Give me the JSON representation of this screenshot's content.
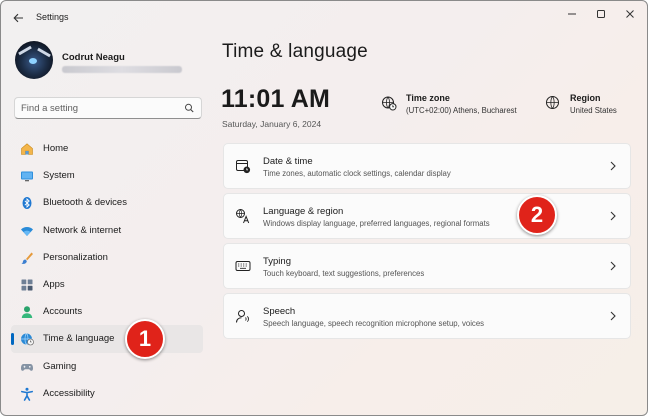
{
  "app": {
    "title": "Settings"
  },
  "user": {
    "name": "Codrut Neagu"
  },
  "search": {
    "placeholder": "Find a setting"
  },
  "sidebar": {
    "items": [
      {
        "label": "Home",
        "icon": "home-icon",
        "active": false
      },
      {
        "label": "System",
        "icon": "monitor-icon",
        "active": false
      },
      {
        "label": "Bluetooth & devices",
        "icon": "bluetooth-icon",
        "active": false
      },
      {
        "label": "Network & internet",
        "icon": "wifi-icon",
        "active": false
      },
      {
        "label": "Personalization",
        "icon": "brush-icon",
        "active": false
      },
      {
        "label": "Apps",
        "icon": "apps-grid-icon",
        "active": false
      },
      {
        "label": "Accounts",
        "icon": "person-icon",
        "active": false
      },
      {
        "label": "Time & language",
        "icon": "globe-clock-icon",
        "active": true
      },
      {
        "label": "Gaming",
        "icon": "gamepad-icon",
        "active": false
      },
      {
        "label": "Accessibility",
        "icon": "accessibility-icon",
        "active": false
      }
    ]
  },
  "main": {
    "page_title": "Time & language",
    "time": "11:01 AM",
    "date": "Saturday, January 6, 2024",
    "timezone": {
      "title": "Time zone",
      "value": "(UTC+02:00) Athens, Bucharest",
      "icon": "globe-clock-icon"
    },
    "region": {
      "title": "Region",
      "value": "United States",
      "icon": "globe-icon"
    },
    "cards": [
      {
        "title": "Date & time",
        "description": "Time zones, automatic clock settings, calendar display",
        "icon": "calendar-clock-icon"
      },
      {
        "title": "Language & region",
        "description": "Windows display language, preferred languages, regional formats",
        "icon": "language-icon"
      },
      {
        "title": "Typing",
        "description": "Touch keyboard, text suggestions, preferences",
        "icon": "keyboard-icon"
      },
      {
        "title": "Speech",
        "description": "Speech language, speech recognition microphone setup, voices",
        "icon": "speech-icon"
      }
    ]
  },
  "annotations": [
    {
      "label": "1"
    },
    {
      "label": "2"
    }
  ],
  "colors": {
    "accent": "#0067c0",
    "marker": "#e0231a"
  }
}
